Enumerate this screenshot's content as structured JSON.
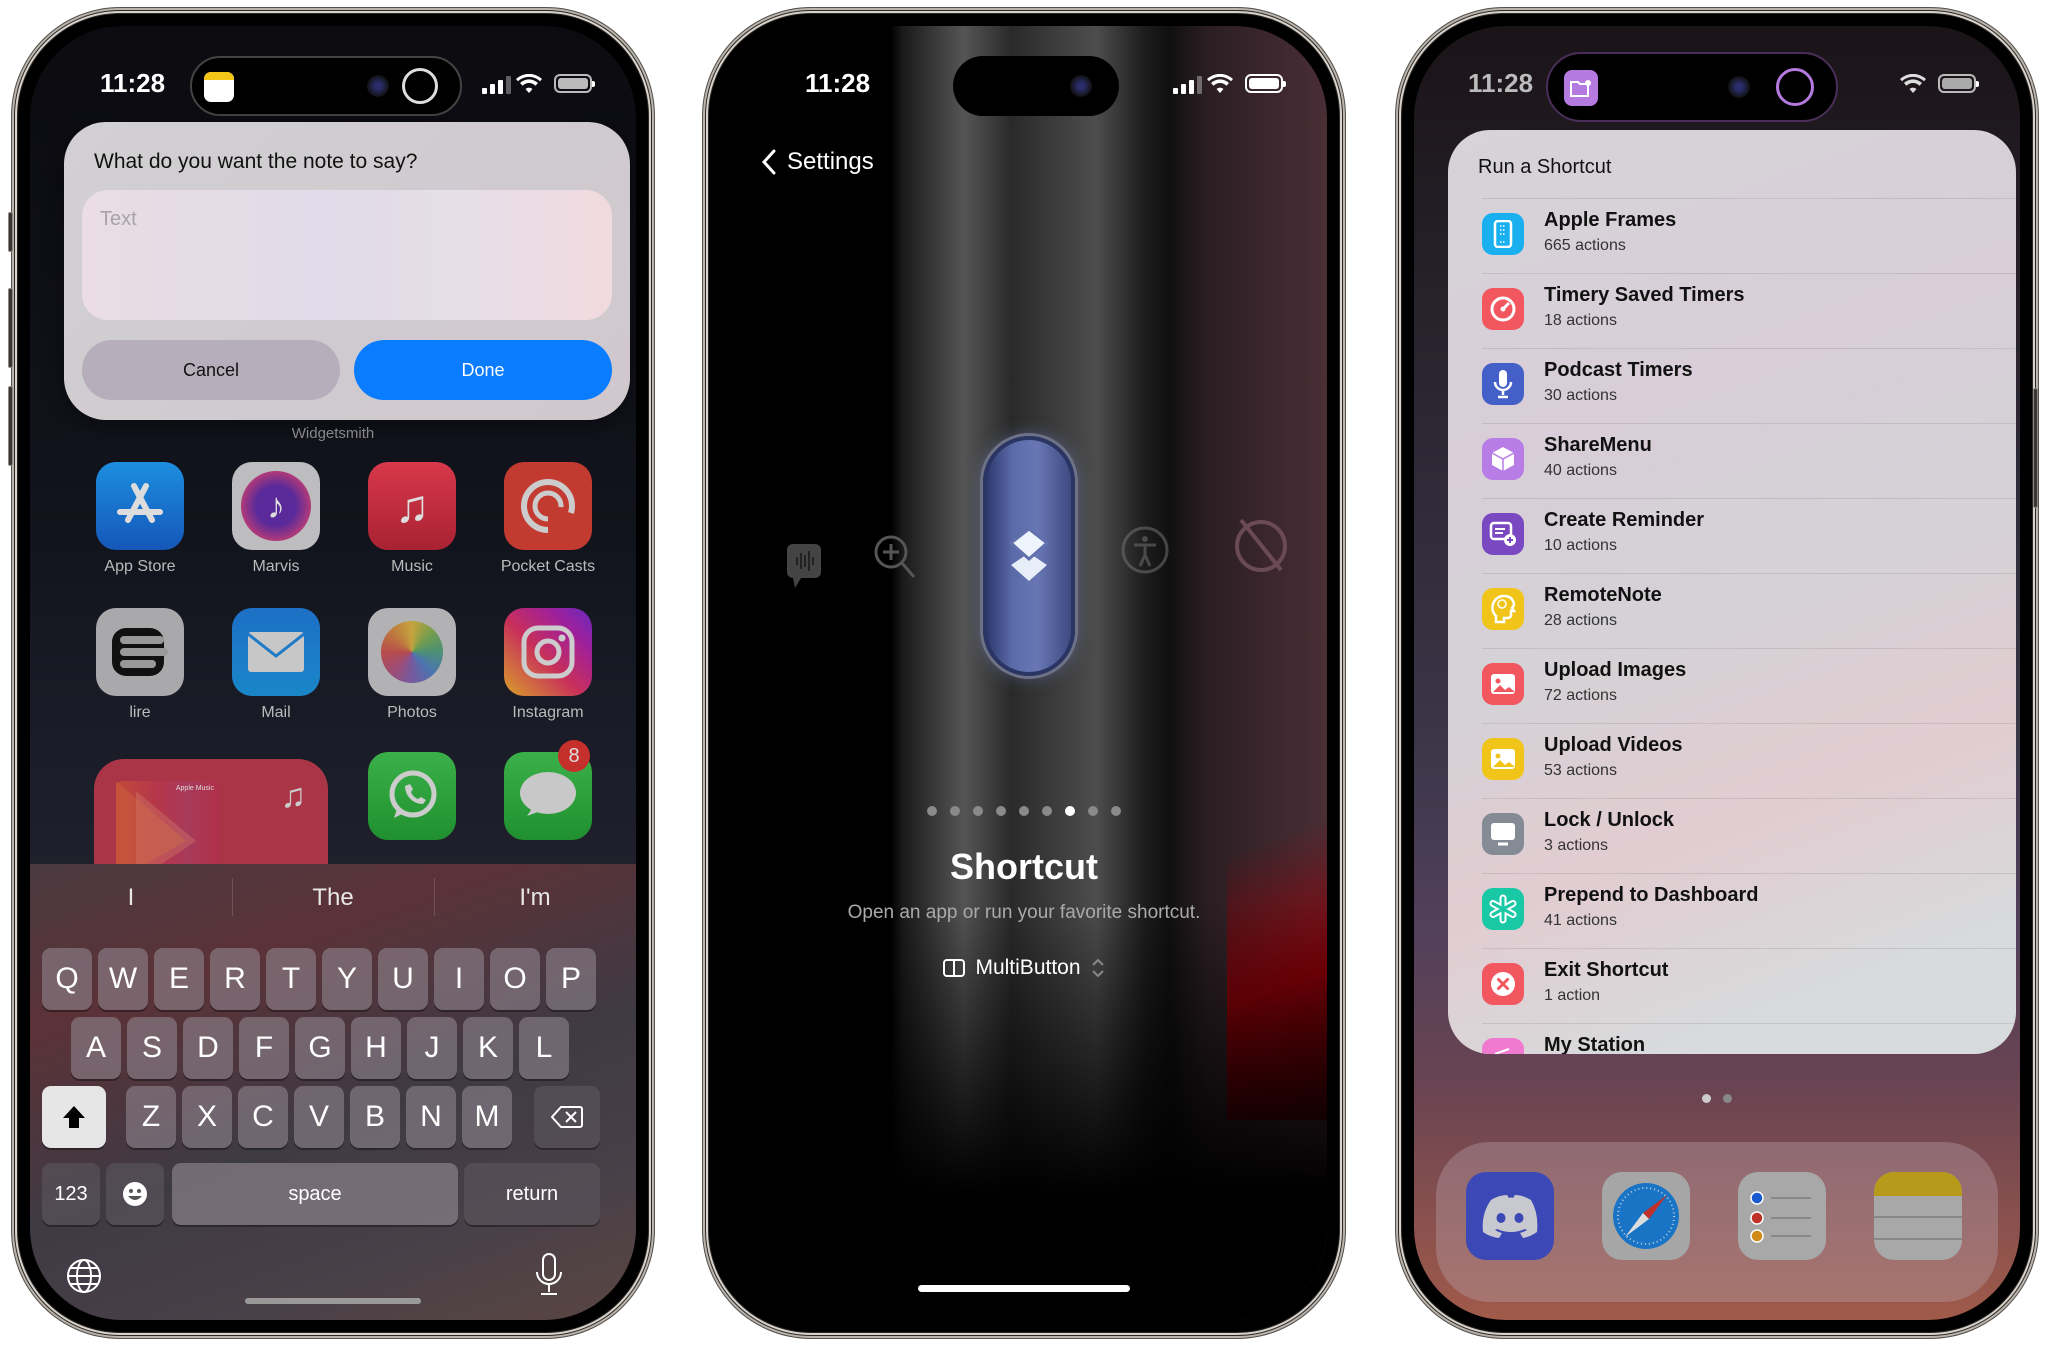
{
  "phone1": {
    "status": {
      "time": "11:28"
    },
    "dynamic_island": {
      "live_activity_app": "Notes",
      "icon": "notes-icon",
      "indicator": "progress-ring"
    },
    "dialog": {
      "prompt": "What do you want the note to say?",
      "input_placeholder": "Text",
      "input_value": "",
      "cancel_label": "Cancel",
      "done_label": "Done"
    },
    "widget_label": "Widgetsmith",
    "apps": [
      {
        "name": "App Store",
        "icon": "app-store-icon",
        "color": "#1a7fd6"
      },
      {
        "name": "Marvis",
        "icon": "marvis-icon",
        "color": "#8a8a8e"
      },
      {
        "name": "Music",
        "icon": "music-icon",
        "color": "#c8303f"
      },
      {
        "name": "Pocket Casts",
        "icon": "pocket-casts-icon",
        "color": "#b93a30"
      },
      {
        "name": "lire",
        "icon": "lire-icon",
        "color": "#a0a0a4"
      },
      {
        "name": "Mail",
        "icon": "mail-icon",
        "color": "#1a78c8"
      },
      {
        "name": "Photos",
        "icon": "photos-icon",
        "color": "#a8a8aa"
      },
      {
        "name": "Instagram",
        "icon": "instagram-icon",
        "color": "#c02a7a"
      },
      {
        "name": "WhatsApp",
        "icon": "whatsapp-icon",
        "color": "#2e9a3a"
      },
      {
        "name": "Messages",
        "icon": "messages-icon",
        "color": "#2e9a3a",
        "badge": "8"
      }
    ],
    "music_widget": {
      "brand": "Apple Music",
      "icon": "music-note-icon"
    },
    "keyboard": {
      "suggestions": [
        "I",
        "The",
        "I'm"
      ],
      "row1": [
        "Q",
        "W",
        "E",
        "R",
        "T",
        "Y",
        "U",
        "I",
        "O",
        "P"
      ],
      "row2": [
        "A",
        "S",
        "D",
        "F",
        "G",
        "H",
        "J",
        "K",
        "L"
      ],
      "row3": [
        "Z",
        "X",
        "C",
        "V",
        "B",
        "N",
        "M"
      ],
      "numbers_label": "123",
      "space_label": "space",
      "return_label": "return",
      "shift_active": true
    }
  },
  "phone2": {
    "status": {
      "time": "11:28"
    },
    "back_label": "Settings",
    "action_title": "Shortcut",
    "action_description": "Open an app or run your favorite shortcut.",
    "selected_shortcut": "MultiButton",
    "page_count": 9,
    "current_page": 7,
    "carousel_icons": [
      "voice-memo-icon",
      "magnifier-icon",
      "shortcuts-icon",
      "accessibility-icon",
      "no-action-icon"
    ],
    "accent": "#5f6eb0"
  },
  "phone3": {
    "status": {
      "time": "11:28"
    },
    "dynamic_island": {
      "live_activity_app": "Shortcuts",
      "icon": "folder-gear-icon",
      "accent": "#b57ae0"
    },
    "panel_title": "Run a Shortcut",
    "shortcuts": [
      {
        "name": "Apple Frames",
        "detail": "665 actions",
        "icon": "phone-frame-icon",
        "color": "#1ab0f0"
      },
      {
        "name": "Timery Saved Timers",
        "detail": "18 actions",
        "icon": "gauge-icon",
        "color": "#f2565e"
      },
      {
        "name": "Podcast Timers",
        "detail": "30 actions",
        "icon": "microphone-icon",
        "color": "#4460c8"
      },
      {
        "name": "ShareMenu",
        "detail": "40 actions",
        "icon": "cube-icon",
        "color": "#b77ce6"
      },
      {
        "name": "Create Reminder",
        "detail": "10 actions",
        "icon": "reminder-add-icon",
        "color": "#7a48c0"
      },
      {
        "name": "RemoteNote",
        "detail": "28 actions",
        "icon": "brain-head-icon",
        "color": "#f0c419"
      },
      {
        "name": "Upload Images",
        "detail": "72 actions",
        "icon": "image-icon",
        "color": "#f2565e"
      },
      {
        "name": "Upload Videos",
        "detail": "53 actions",
        "icon": "image-icon",
        "color": "#f0c419"
      },
      {
        "name": "Lock / Unlock",
        "detail": "3 actions",
        "icon": "display-icon",
        "color": "#858b94"
      },
      {
        "name": "Prepend to Dashboard",
        "detail": "41 actions",
        "icon": "asterisk-icon",
        "color": "#19c9a5"
      },
      {
        "name": "Exit Shortcut",
        "detail": "1 action",
        "icon": "close-circle-icon",
        "color": "#f2565e"
      },
      {
        "name": "My Station",
        "detail": "",
        "icon": "radio-icon",
        "color": "#f07ad0"
      }
    ],
    "page_count": 2,
    "current_page": 1,
    "dock": [
      {
        "name": "Discord",
        "icon": "discord-icon",
        "color": "#3b48b5"
      },
      {
        "name": "Safari",
        "icon": "safari-icon",
        "color": "#a6a6a6"
      },
      {
        "name": "Reminders",
        "icon": "reminders-icon",
        "color": "#a8a8a8"
      },
      {
        "name": "Notes",
        "icon": "notes-icon",
        "color": "#a8a8a8"
      }
    ]
  }
}
